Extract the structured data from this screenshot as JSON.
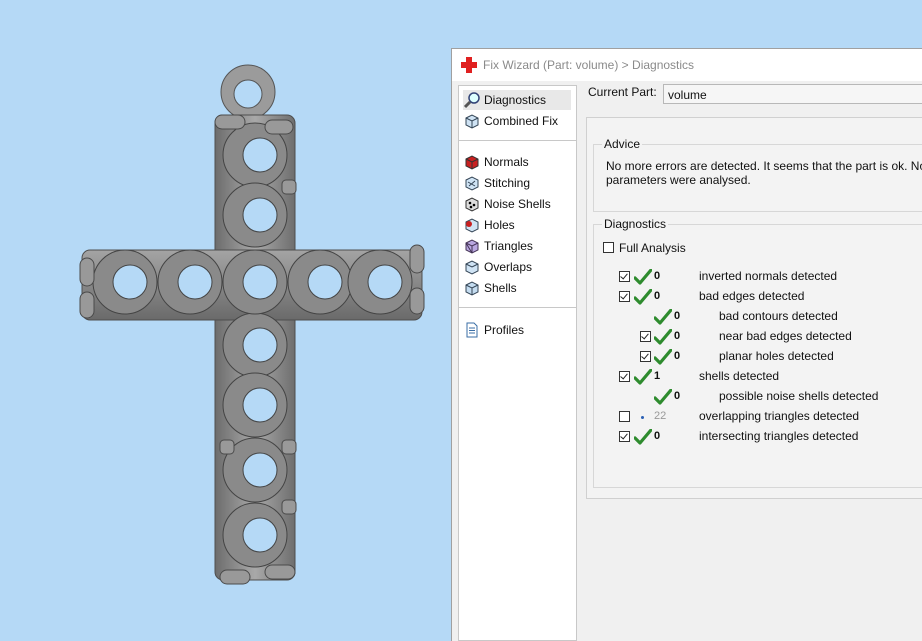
{
  "window": {
    "title": "Fix Wizard (Part: volume) > Diagnostics"
  },
  "sidebar": {
    "items": [
      {
        "label": "Diagnostics",
        "icon": "magnifier-icon",
        "selected": true
      },
      {
        "label": "Combined Fix",
        "icon": "cube-icon"
      },
      {
        "label": "Normals",
        "icon": "red-cube-icon"
      },
      {
        "label": "Stitching",
        "icon": "stitching-icon"
      },
      {
        "label": "Noise Shells",
        "icon": "noise-shells-icon"
      },
      {
        "label": "Holes",
        "icon": "holes-icon"
      },
      {
        "label": "Triangles",
        "icon": "triangles-icon"
      },
      {
        "label": "Overlaps",
        "icon": "overlaps-icon"
      },
      {
        "label": "Shells",
        "icon": "shells-icon"
      },
      {
        "label": "Profiles",
        "icon": "document-icon"
      }
    ]
  },
  "current_part": {
    "label": "Current Part:",
    "value": "volume"
  },
  "advice": {
    "title": "Advice",
    "text": "No more errors are detected. It seems that the part is ok. Note parameters were analysed."
  },
  "diagnostics": {
    "title": "Diagnostics",
    "full_analysis": "Full Analysis",
    "rows": [
      {
        "count": "0",
        "label": "inverted normals detected",
        "checked": true,
        "status": "ok"
      },
      {
        "count": "0",
        "label": "bad edges detected",
        "checked": true,
        "status": "ok"
      },
      {
        "count": "0",
        "label": "bad contours detected",
        "status": "ok"
      },
      {
        "count": "0",
        "label": "near bad edges detected",
        "checked": true,
        "status": "ok"
      },
      {
        "count": "0",
        "label": "planar holes detected",
        "checked": true,
        "status": "ok"
      },
      {
        "count": "1",
        "label": "shells detected",
        "checked": true,
        "status": "ok"
      },
      {
        "count": "0",
        "label": "possible noise shells detected",
        "status": "ok"
      },
      {
        "count": "22",
        "label": "overlapping triangles detected",
        "checked": false,
        "status": "not-analysed"
      },
      {
        "count": "0",
        "label": "intersecting triangles detected",
        "checked": true,
        "status": "ok"
      }
    ]
  },
  "colors": {
    "background": "#b5d9f6",
    "check_green": "#2e8b2e",
    "model_gray": "#8c8c8c"
  }
}
